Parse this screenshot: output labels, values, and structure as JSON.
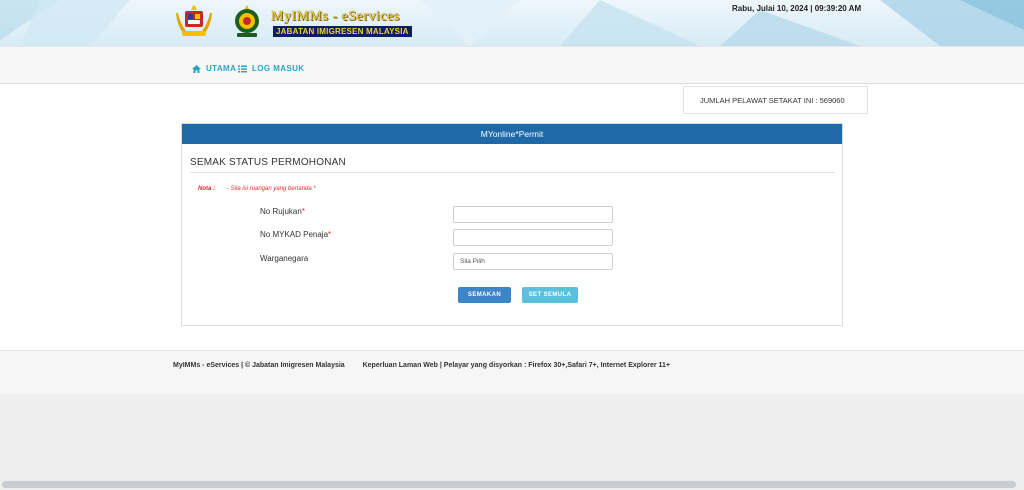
{
  "header": {
    "brand_title": "MyIMMs - eServices",
    "brand_subtitle": "JABATAN IMIGRESEN MALAYSIA",
    "datetime": "Rabu, Julai 10, 2024 | 09:39:20 AM",
    "crest_icons": [
      "malaysia-coat-of-arms-icon",
      "immigration-department-crest-icon"
    ]
  },
  "nav": {
    "items": [
      {
        "label": "UTAMA",
        "icon": "home-icon"
      },
      {
        "label": "LOG MASUK",
        "icon": "list-icon"
      }
    ]
  },
  "visitor_counter": "JUMLAH PELAWAT SETAKAT INI : 569060",
  "panel": {
    "title": "MYonline*Permit",
    "section_title": "SEMAK STATUS PERMOHONAN",
    "note_label": "Nota :",
    "note_text": "-  Sila isi ruangan yang bertanda *",
    "fields": [
      {
        "label": "No Rujukan",
        "required_mark": "*",
        "value": ""
      },
      {
        "label": "No MYKAD Penaja",
        "required_mark": "*",
        "value": ""
      },
      {
        "label": "Warganegara",
        "required_mark": "",
        "value": "Sila Pilih"
      }
    ],
    "buttons": {
      "check": "SEMAKAN",
      "reset": "SET SEMULA"
    }
  },
  "footer": {
    "copyright": "MyIMMs - eServices | © Jabatan Imigresen Malaysia",
    "requirements": "Keperluan Laman Web | Pelayar yang disyorkan : Firefox 30+,Safari 7+, Internet Explorer 11+"
  },
  "colors": {
    "panel_header": "#1e6aa8",
    "check_button": "#3a86c8",
    "reset_button": "#5bc0de",
    "nav_link": "#2aa5c4",
    "required": "#d9302b"
  }
}
